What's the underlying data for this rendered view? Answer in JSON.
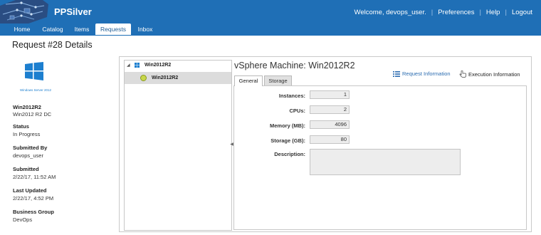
{
  "header": {
    "app_name": "PPSilver",
    "welcome": "Welcome, devops_user.",
    "links": [
      "Preferences",
      "Help",
      "Logout"
    ]
  },
  "tabs": [
    {
      "label": "Home",
      "active": false
    },
    {
      "label": "Catalog",
      "active": false
    },
    {
      "label": "Items",
      "active": false
    },
    {
      "label": "Requests",
      "active": true
    },
    {
      "label": "Inbox",
      "active": false
    }
  ],
  "page_title": "Request #28 Details",
  "sidebar": {
    "logo_caption": "Windows Server 2012",
    "item_name": "Win2012R2",
    "item_desc": "Win2012 R2 DC",
    "fields": [
      {
        "label": "Status",
        "value": "In Progress"
      },
      {
        "label": "Submitted By",
        "value": "devops_user"
      },
      {
        "label": "Submitted",
        "value": "2/22/17, 11:52 AM"
      },
      {
        "label": "Last Updated",
        "value": "2/22/17, 4:52 PM"
      },
      {
        "label": "Business Group",
        "value": "DevOps"
      }
    ]
  },
  "tree": {
    "root_label": "Win2012R2",
    "child_label": "Win2012R2"
  },
  "detail": {
    "title": "vSphere Machine: Win2012R2",
    "request_info_link": "Request Information",
    "execution_info_link": "Execution Information",
    "tabs": [
      {
        "label": "General",
        "active": true
      },
      {
        "label": "Storage",
        "active": false
      }
    ],
    "fields": [
      {
        "label": "Instances:",
        "value": "1"
      },
      {
        "label": "CPUs:",
        "value": "2"
      },
      {
        "label": "Memory (MB):",
        "value": "4096"
      },
      {
        "label": "Storage (GB):",
        "value": "80"
      }
    ],
    "description_label": "Description:",
    "description_value": ""
  },
  "colors": {
    "header_blue": "#1f6fb6",
    "link_blue": "#2b6cb0",
    "windows_blue": "#1d7fcf"
  }
}
